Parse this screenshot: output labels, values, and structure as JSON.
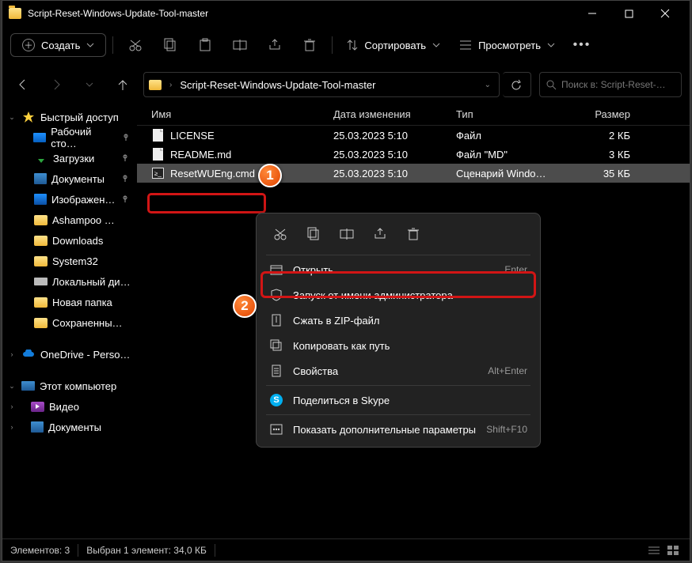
{
  "title": "Script-Reset-Windows-Update-Tool-master",
  "toolbar": {
    "create": "Создать",
    "sort": "Сортировать",
    "view": "Просмотреть"
  },
  "breadcrumb": "Script-Reset-Windows-Update-Tool-master",
  "search_placeholder": "Поиск в: Script-Reset-…",
  "columns": {
    "name": "Имя",
    "date": "Дата изменения",
    "type": "Тип",
    "size": "Размер"
  },
  "files": [
    {
      "name": "LICENSE",
      "date": "25.03.2023 5:10",
      "type": "Файл",
      "size": "2 КБ",
      "icon": "file"
    },
    {
      "name": "README.md",
      "date": "25.03.2023 5:10",
      "type": "Файл \"MD\"",
      "size": "3 КБ",
      "icon": "file"
    },
    {
      "name": "ResetWUEng.cmd",
      "date": "25.03.2023 5:10",
      "type": "Сценарий Windo…",
      "size": "35 КБ",
      "icon": "cmd"
    }
  ],
  "sidebar": {
    "quick": "Быстрый доступ",
    "items": [
      "Рабочий сто…",
      "Загрузки",
      "Документы",
      "Изображен…",
      "Ashampoo …",
      "Downloads",
      "System32",
      "Локальный ди…",
      "Новая папка",
      "Сохраненны…"
    ],
    "onedrive": "OneDrive - Perso…",
    "thispc": "Этот компьютер",
    "pcitems": [
      "Видео",
      "Документы"
    ]
  },
  "ctx": {
    "open": "Открыть",
    "open_sc": "Enter",
    "admin": "Запуск от имени администратора",
    "zip": "Сжать в ZIP-файл",
    "copypath": "Копировать как путь",
    "props": "Свойства",
    "props_sc": "Alt+Enter",
    "skype": "Поделиться в Skype",
    "more": "Показать дополнительные параметры",
    "more_sc": "Shift+F10"
  },
  "status": {
    "items": "Элементов: 3",
    "sel": "Выбран 1 элемент: 34,0 КБ"
  }
}
